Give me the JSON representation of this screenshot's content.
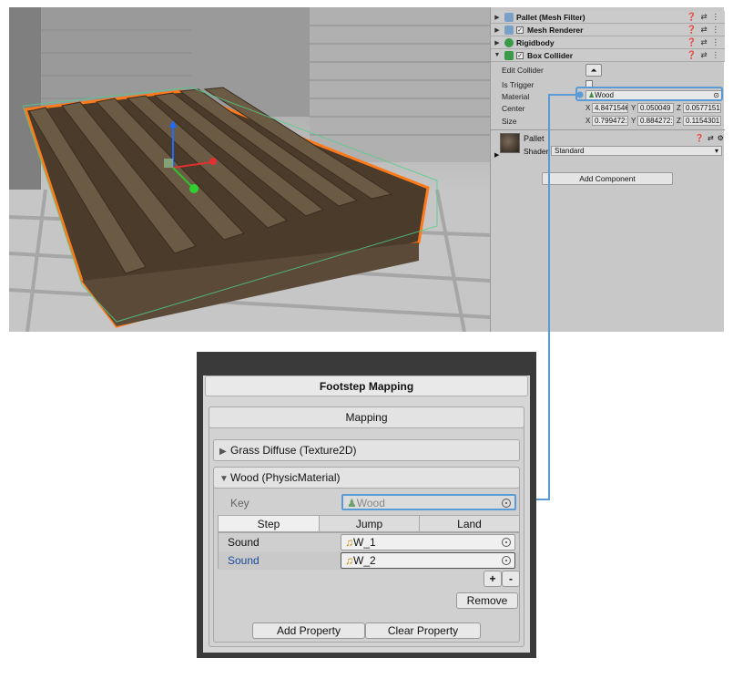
{
  "inspector": {
    "components": [
      {
        "name": "Pallet (Mesh Filter)",
        "icon": "grid-icon",
        "checkbox": false
      },
      {
        "name": "Mesh Renderer",
        "icon": "mesh-renderer-icon",
        "checkbox": true
      },
      {
        "name": "Rigidbody",
        "icon": "rigidbody-icon",
        "checkbox": false
      },
      {
        "name": "Box Collider",
        "icon": "box-collider-icon",
        "checkbox": true
      }
    ],
    "box_collider": {
      "edit_collider_label": "Edit Collider",
      "is_trigger_label": "Is Trigger",
      "material_label": "Material",
      "material_value": "Wood",
      "center_label": "Center",
      "center": {
        "x": "4.847154€",
        "y": "0.050049",
        "z": "0.0577151"
      },
      "size_label": "Size",
      "size": {
        "x": "0.799472:",
        "y": "0.884272:",
        "z": "0.1154301"
      }
    },
    "material": {
      "name": "Pallet",
      "shader_label": "Shader",
      "shader_value": "Standard"
    },
    "add_component_label": "Add Component",
    "axis_labels": {
      "x": "X",
      "y": "Y",
      "z": "Z"
    }
  },
  "footstep": {
    "title": "Footstep Mapping",
    "mapping_header": "Mapping",
    "entries": [
      {
        "label": "Grass Diffuse (Texture2D)",
        "expanded": false
      },
      {
        "label": "Wood (PhysicMaterial)",
        "expanded": true
      }
    ],
    "key_label": "Key",
    "key_value": "Wood",
    "tabs": [
      "Step",
      "Jump",
      "Land"
    ],
    "rows": [
      {
        "label": "Sound",
        "value": "W_1"
      },
      {
        "label": "Sound",
        "value": "W_2"
      }
    ],
    "plus_label": "+",
    "minus_label": "-",
    "remove_label": "Remove",
    "add_property_label": "Add Property",
    "clear_property_label": "Clear Property"
  },
  "colors": {
    "highlight": "#5b9bd5",
    "selection_outline": "#ff7a1a"
  }
}
